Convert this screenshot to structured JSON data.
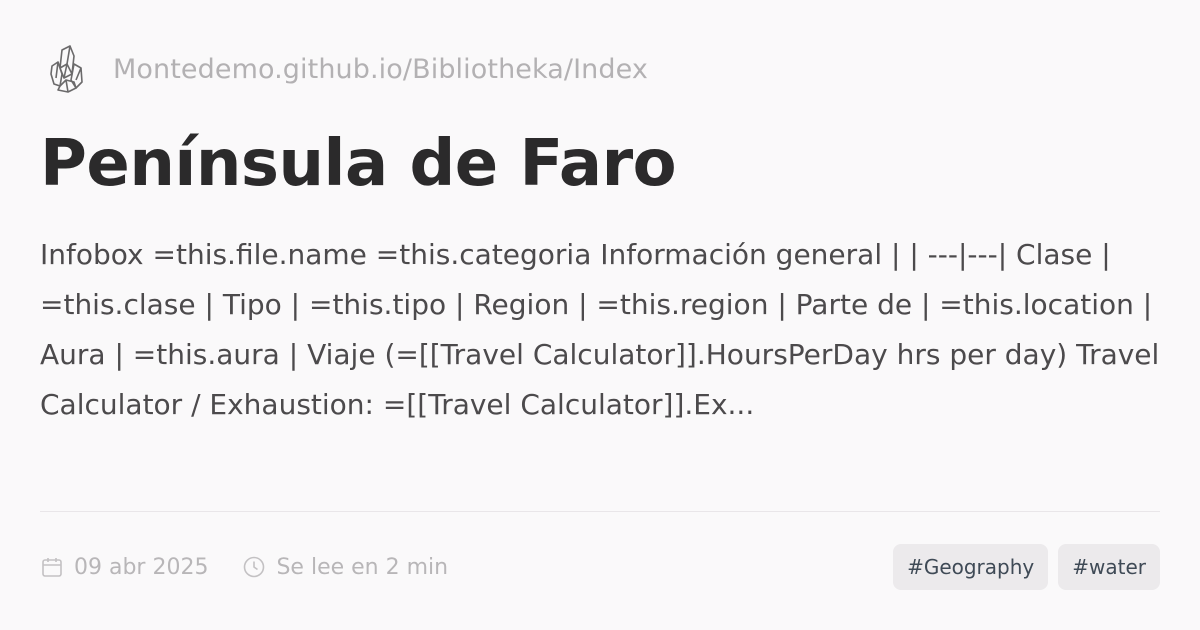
{
  "site": {
    "url": "Montedemo.github.io/Bibliotheka/Index",
    "logo_icon": "crystal-cluster-icon"
  },
  "page": {
    "title": "Península de Faro",
    "excerpt": "Infobox =this.file.name =this.categoria Información general | | ---|---| Clase | =this.clase | Tipo | =this.tipo | Region | =this.region | Parte de | =this.location | Aura | =this.aura | Viaje (=[[Travel Calculator]].HoursPerDay hrs per day) Travel Calculator / Exhaustion: =[[Travel Calculator]].Ex..."
  },
  "meta": {
    "date": "09 abr 2025",
    "date_icon": "calendar-icon",
    "reading_time": "Se lee en 2 min",
    "reading_icon": "clock-icon"
  },
  "tags": [
    {
      "label": "#Geography"
    },
    {
      "label": "#water"
    }
  ],
  "colors": {
    "background": "#faf9fa",
    "title": "#2b2a2b",
    "muted": "#b3b1b3",
    "tag_bg": "#eceaec",
    "tag_text": "#3f4a56"
  }
}
